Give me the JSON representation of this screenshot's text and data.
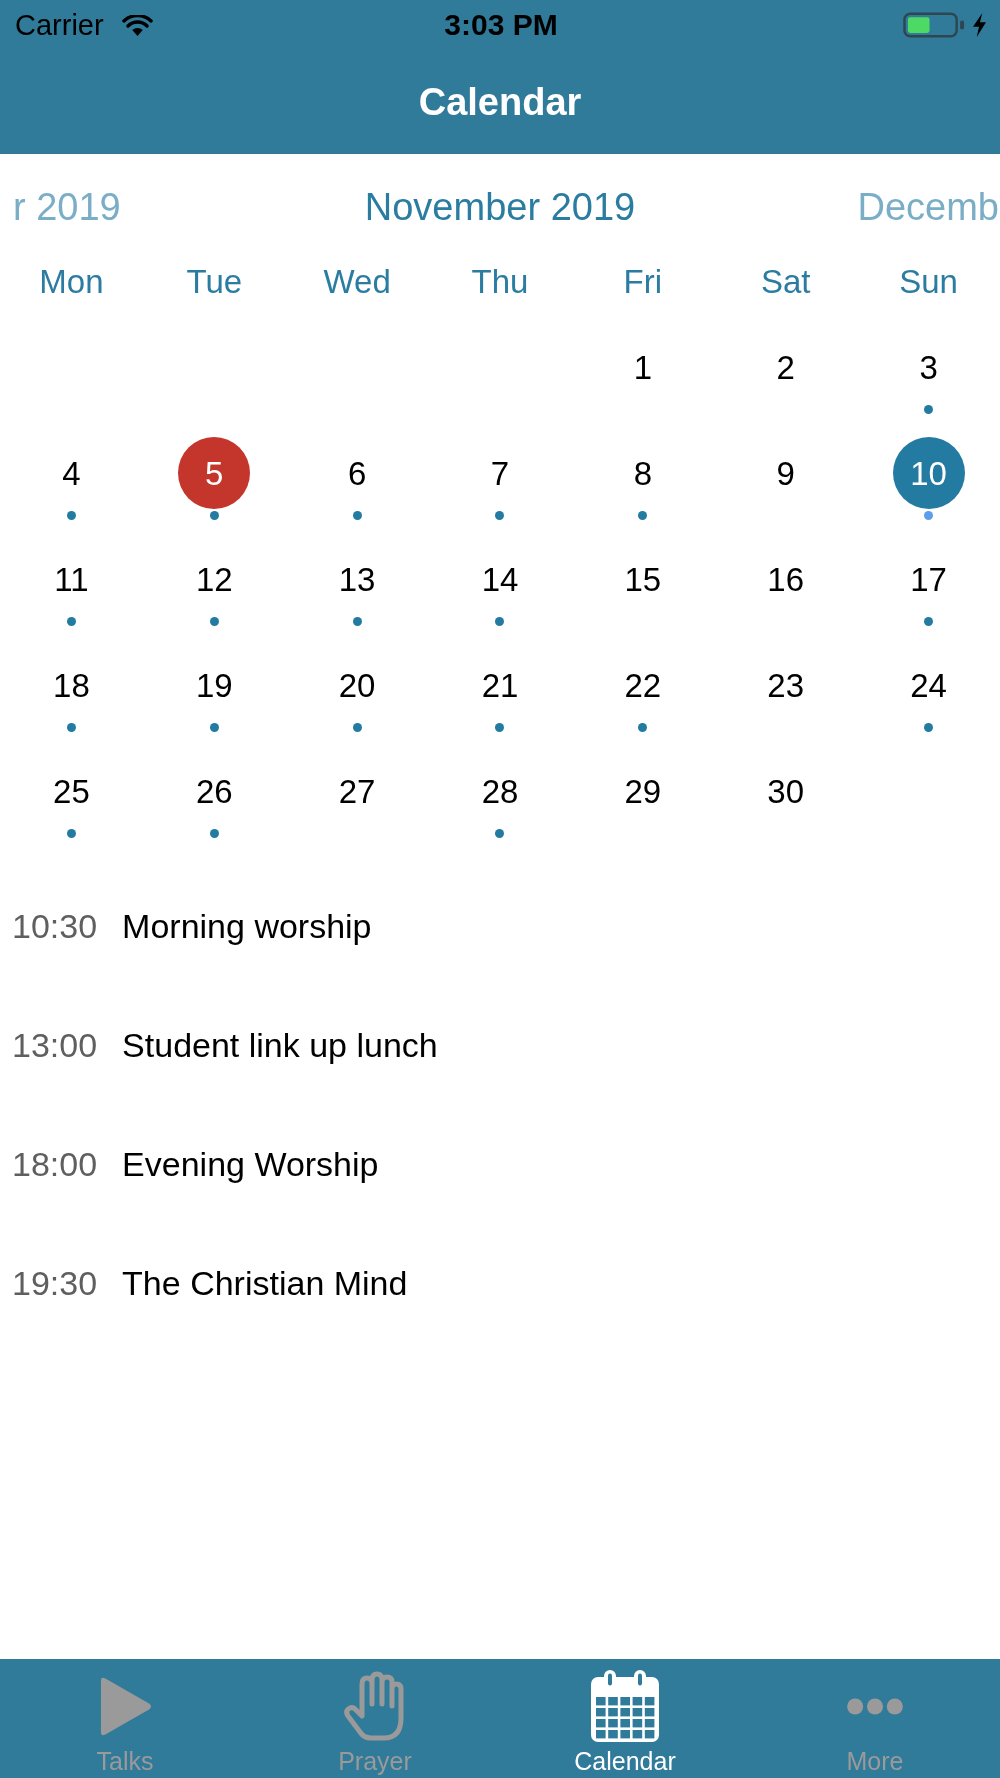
{
  "status_bar": {
    "carrier": "Carrier",
    "time": "3:03 PM"
  },
  "nav_bar": {
    "title": "Calendar"
  },
  "calendar": {
    "months": [
      {
        "label": "r 2019",
        "selected": false
      },
      {
        "label": "November 2019",
        "selected": true
      },
      {
        "label": "Decemb",
        "selected": false
      }
    ],
    "weekdays": [
      "Mon",
      "Tue",
      "Wed",
      "Thu",
      "Fri",
      "Sat",
      "Sun"
    ],
    "weeks": [
      [
        {
          "kind": "empty"
        },
        {
          "kind": "empty"
        },
        {
          "kind": "empty"
        },
        {
          "kind": "empty"
        },
        {
          "kind": "day",
          "label": "1",
          "has_events": false,
          "today": false,
          "selected": false
        },
        {
          "kind": "day",
          "label": "2",
          "has_events": false,
          "today": false,
          "selected": false
        },
        {
          "kind": "day",
          "label": "3",
          "has_events": true,
          "today": false,
          "selected": false
        }
      ],
      [
        {
          "kind": "day",
          "label": "4",
          "has_events": true,
          "today": false,
          "selected": false
        },
        {
          "kind": "day",
          "label": "5",
          "has_events": true,
          "today": true,
          "selected": false
        },
        {
          "kind": "day",
          "label": "6",
          "has_events": true,
          "today": false,
          "selected": false
        },
        {
          "kind": "day",
          "label": "7",
          "has_events": true,
          "today": false,
          "selected": false
        },
        {
          "kind": "day",
          "label": "8",
          "has_events": true,
          "today": false,
          "selected": false
        },
        {
          "kind": "day",
          "label": "9",
          "has_events": false,
          "today": false,
          "selected": false
        },
        {
          "kind": "day",
          "label": "10",
          "has_events": true,
          "today": false,
          "selected": true
        }
      ],
      [
        {
          "kind": "day",
          "label": "11",
          "has_events": true,
          "today": false,
          "selected": false
        },
        {
          "kind": "day",
          "label": "12",
          "has_events": true,
          "today": false,
          "selected": false
        },
        {
          "kind": "day",
          "label": "13",
          "has_events": true,
          "today": false,
          "selected": false
        },
        {
          "kind": "day",
          "label": "14",
          "has_events": true,
          "today": false,
          "selected": false
        },
        {
          "kind": "day",
          "label": "15",
          "has_events": false,
          "today": false,
          "selected": false
        },
        {
          "kind": "day",
          "label": "16",
          "has_events": false,
          "today": false,
          "selected": false
        },
        {
          "kind": "day",
          "label": "17",
          "has_events": true,
          "today": false,
          "selected": false
        }
      ],
      [
        {
          "kind": "day",
          "label": "18",
          "has_events": true,
          "today": false,
          "selected": false
        },
        {
          "kind": "day",
          "label": "19",
          "has_events": true,
          "today": false,
          "selected": false
        },
        {
          "kind": "day",
          "label": "20",
          "has_events": true,
          "today": false,
          "selected": false
        },
        {
          "kind": "day",
          "label": "21",
          "has_events": true,
          "today": false,
          "selected": false
        },
        {
          "kind": "day",
          "label": "22",
          "has_events": true,
          "today": false,
          "selected": false
        },
        {
          "kind": "day",
          "label": "23",
          "has_events": false,
          "today": false,
          "selected": false
        },
        {
          "kind": "day",
          "label": "24",
          "has_events": true,
          "today": false,
          "selected": false
        }
      ],
      [
        {
          "kind": "day",
          "label": "25",
          "has_events": true,
          "today": false,
          "selected": false
        },
        {
          "kind": "day",
          "label": "26",
          "has_events": true,
          "today": false,
          "selected": false
        },
        {
          "kind": "day",
          "label": "27",
          "has_events": false,
          "today": false,
          "selected": false
        },
        {
          "kind": "day",
          "label": "28",
          "has_events": true,
          "today": false,
          "selected": false
        },
        {
          "kind": "day",
          "label": "29",
          "has_events": false,
          "today": false,
          "selected": false
        },
        {
          "kind": "day",
          "label": "30",
          "has_events": false,
          "today": false,
          "selected": false
        }
      ]
    ]
  },
  "events": [
    {
      "time": "10:30",
      "title": "Morning worship"
    },
    {
      "time": "13:00",
      "title": "Student link up lunch"
    },
    {
      "time": "18:00",
      "title": "Evening Worship"
    },
    {
      "time": "19:30",
      "title": "The Christian Mind"
    }
  ],
  "tab_bar": {
    "tabs": [
      {
        "label": "Talks",
        "selected": false
      },
      {
        "label": "Prayer",
        "selected": false
      },
      {
        "label": "Calendar",
        "selected": true
      },
      {
        "label": "More",
        "selected": false
      }
    ]
  }
}
